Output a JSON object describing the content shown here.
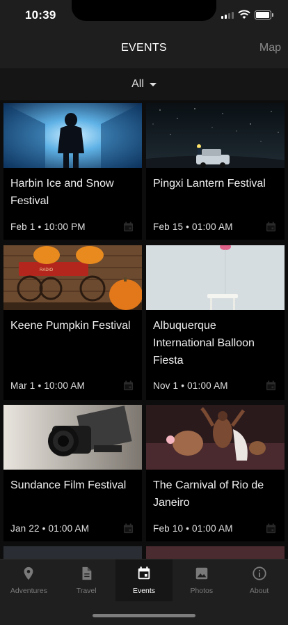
{
  "status": {
    "time": "10:39"
  },
  "header": {
    "title": "EVENTS",
    "map_label": "Map"
  },
  "filter": {
    "label": "All"
  },
  "events": [
    {
      "title": "Harbin Ice and Snow Festival",
      "date": "Feb 1 • 10:00 PM"
    },
    {
      "title": "Pingxi Lantern Festival",
      "date": "Feb 15 • 01:00 AM"
    },
    {
      "title": "Keene Pumpkin Festival",
      "date": "Mar 1 • 10:00 AM"
    },
    {
      "title": "Albuquerque International Balloon Fiesta",
      "date": "Nov 1 • 01:00 AM"
    },
    {
      "title": "Sundance Film Festival",
      "date": "Jan 22 • 01:00 AM"
    },
    {
      "title": "The Carnival of Rio de Janeiro",
      "date": "Feb 10 • 01:00 AM"
    }
  ],
  "tabs": [
    {
      "label": "Adventures",
      "icon": "location-pin-icon"
    },
    {
      "label": "Travel",
      "icon": "document-icon"
    },
    {
      "label": "Events",
      "icon": "calendar-icon",
      "active": true
    },
    {
      "label": "Photos",
      "icon": "image-icon"
    },
    {
      "label": "About",
      "icon": "info-icon"
    }
  ],
  "colors": {
    "background": "#0d0d0d",
    "bar": "#1e1e1e",
    "card": "#000000",
    "muted": "#7a7a7a"
  }
}
